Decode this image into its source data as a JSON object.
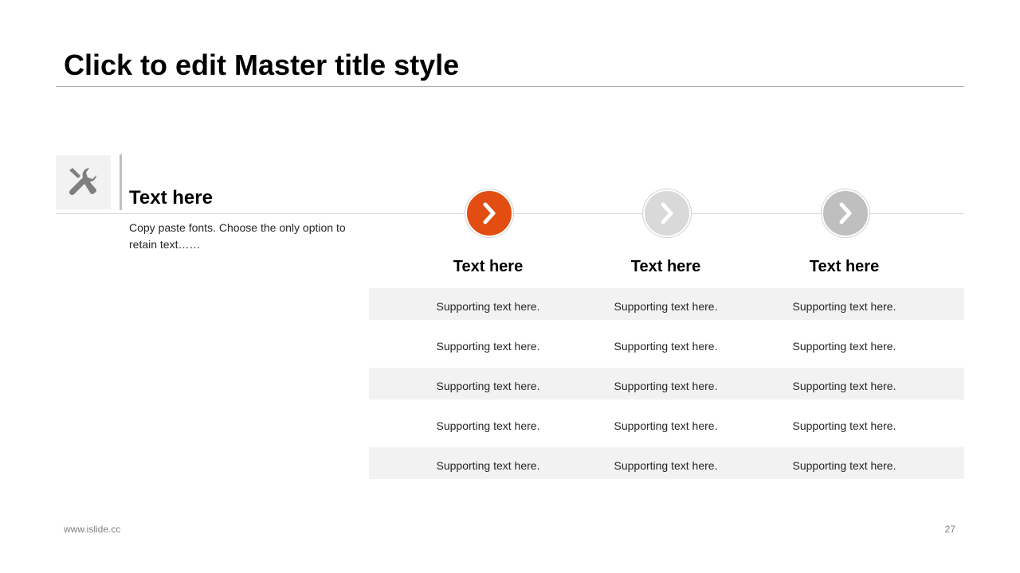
{
  "slide": {
    "title": "Click to edit Master title style",
    "feature": {
      "icon": "tools-icon",
      "heading": "Text here",
      "body": "Copy paste fonts. Choose the only option to retain text……"
    },
    "columns": [
      {
        "heading": "Text here",
        "icon": "chevron-right-icon",
        "color": "#e24e12"
      },
      {
        "heading": "Text here",
        "icon": "chevron-right-icon",
        "color": "#d9d9d9"
      },
      {
        "heading": "Text here",
        "icon": "chevron-right-icon",
        "color": "#bfbfbf"
      }
    ],
    "rows": [
      [
        "Supporting text here.",
        "Supporting text here.",
        "Supporting text here."
      ],
      [
        "Supporting text here.",
        "Supporting text here.",
        "Supporting text here."
      ],
      [
        "Supporting text here.",
        "Supporting text here.",
        "Supporting text here."
      ],
      [
        "Supporting text here.",
        "Supporting text here.",
        "Supporting text here."
      ],
      [
        "Supporting text here.",
        "Supporting text here.",
        "Supporting text here."
      ]
    ],
    "footer": {
      "website": "www.islide.cc",
      "page_number": "27"
    },
    "colors": {
      "accent": "#e24e12",
      "row_shade": "#f2f2f2"
    }
  }
}
